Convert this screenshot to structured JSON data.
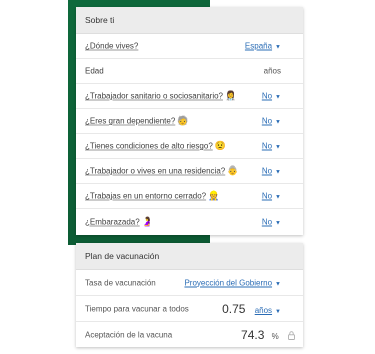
{
  "about": {
    "header": "Sobre ti",
    "rows": [
      {
        "label": "¿Dónde vives?",
        "value": "España"
      },
      {
        "label": "Edad",
        "value": "años"
      },
      {
        "label": "¿Trabajador sanitario o sociosanitario?",
        "value": "No",
        "icon": "health-worker-icon"
      },
      {
        "label": "¿Eres gran dependiente?",
        "value": "No",
        "icon": "dependent-person-icon"
      },
      {
        "label": "¿Tienes condiciones de alto riesgo?",
        "value": "No",
        "icon": "worried-face-icon"
      },
      {
        "label": "¿Trabajador o vives en una residencia?",
        "value": "No",
        "icon": "elderly-face-icon"
      },
      {
        "label": "¿Trabajas en un entorno cerrado?",
        "value": "No",
        "icon": "worker-icon"
      },
      {
        "label": "¿Embarazada?",
        "value": "No",
        "icon": "pregnant-icon"
      }
    ]
  },
  "plan": {
    "header": "Plan de vacunación",
    "rate": {
      "label": "Tasa de vacunación",
      "value": "Proyección del Gobierno"
    },
    "time": {
      "label": "Tiempo para vacunar a todos",
      "value": "0.75",
      "unit": "años"
    },
    "acceptance": {
      "label": "Aceptación de la vacuna",
      "value": "74.3",
      "unit": "%"
    }
  },
  "colors": {
    "background_accent": "#0f6f3f",
    "link": "#2a6cb5",
    "header_bg": "#ececec"
  }
}
